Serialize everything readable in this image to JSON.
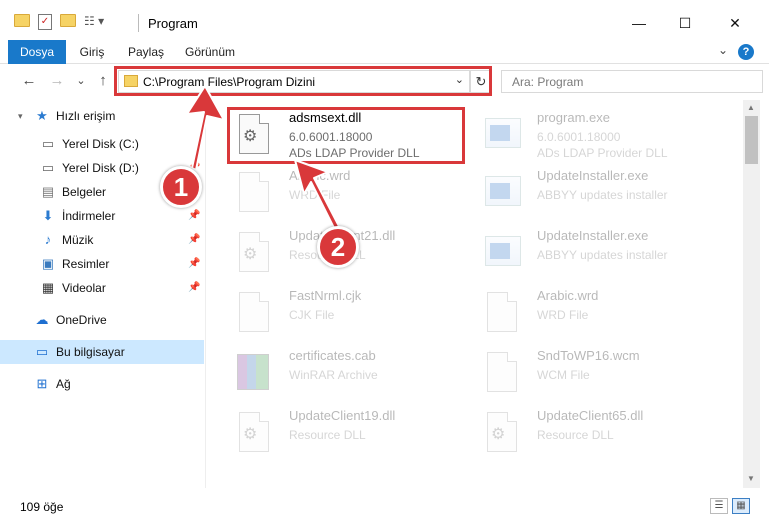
{
  "window": {
    "title": "Program",
    "min_glyph": "—",
    "max_glyph": "☐",
    "close_glyph": "✕"
  },
  "ribbon": {
    "tabs": [
      "Dosya",
      "Giriş",
      "Paylaş",
      "Görünüm"
    ],
    "help": "?",
    "collapse_glyph": "⌄"
  },
  "nav": {
    "back": "←",
    "forward": "→",
    "recent": "⌄",
    "up": "↑",
    "address": "C:\\Program Files\\Program Dizini",
    "address_dropdown": "⌄",
    "refresh": "↻",
    "search_placeholder": "Ara: Program"
  },
  "sidebar": {
    "quick_access": "Hızlı erişim",
    "items": [
      {
        "label": "Yerel Disk (C:)",
        "icon": "drive-icon",
        "pinned": false
      },
      {
        "label": "Yerel Disk (D:)",
        "icon": "drive-icon",
        "pinned": true
      },
      {
        "label": "Belgeler",
        "icon": "documents-icon",
        "pinned": true
      },
      {
        "label": "İndirmeler",
        "icon": "downloads-icon",
        "pinned": true
      },
      {
        "label": "Müzik",
        "icon": "music-icon",
        "pinned": true
      },
      {
        "label": "Resimler",
        "icon": "pictures-icon",
        "pinned": true
      },
      {
        "label": "Videolar",
        "icon": "videos-icon",
        "pinned": true
      }
    ],
    "onedrive": "OneDrive",
    "this_pc": "Bu bilgisayar",
    "network": "Ağ"
  },
  "files": [
    {
      "name": "adsmsext.dll",
      "line2": "6.0.6001.18000",
      "line3": "ADs LDAP Provider DLL",
      "icon": "dll-file-icon",
      "highlighted": true
    },
    {
      "name": "program.exe",
      "line2": "6.0.6001.18000",
      "line3": "ADs LDAP Provider DLL",
      "icon": "exe-file-icon"
    },
    {
      "name": "Arabic.wrd",
      "line2": "WRD File",
      "line3": "",
      "icon": "document-file-icon"
    },
    {
      "name": "UpdateInstaller.exe",
      "line2": "ABBYY updates installer",
      "line3": "",
      "icon": "exe-file-icon"
    },
    {
      "name": "UpdateClient21.dll",
      "line2": "Resource DLL",
      "line3": "",
      "icon": "dll-file-icon"
    },
    {
      "name": "UpdateInstaller.exe",
      "line2": "ABBYY updates installer",
      "line3": "",
      "icon": "exe-file-icon"
    },
    {
      "name": "FastNrml.cjk",
      "line2": "CJK File",
      "line3": "",
      "icon": "document-file-icon"
    },
    {
      "name": "Arabic.wrd",
      "line2": "WRD File",
      "line3": "",
      "icon": "document-file-icon"
    },
    {
      "name": "certificates.cab",
      "line2": "WinRAR Archive",
      "line3": "",
      "icon": "archive-file-icon"
    },
    {
      "name": "SndToWP16.wcm",
      "line2": "WCM File",
      "line3": "",
      "icon": "document-file-icon"
    },
    {
      "name": "UpdateClient19.dll",
      "line2": "Resource DLL",
      "line3": "",
      "icon": "dll-file-icon"
    },
    {
      "name": "UpdateClient65.dll",
      "line2": "Resource DLL",
      "line3": "",
      "icon": "dll-file-icon"
    }
  ],
  "status": {
    "count": "109 öğe"
  },
  "callouts": [
    "1",
    "2"
  ],
  "colors": {
    "accent": "#1979ca",
    "highlight": "#d9383a",
    "selection": "#cce8ff"
  }
}
